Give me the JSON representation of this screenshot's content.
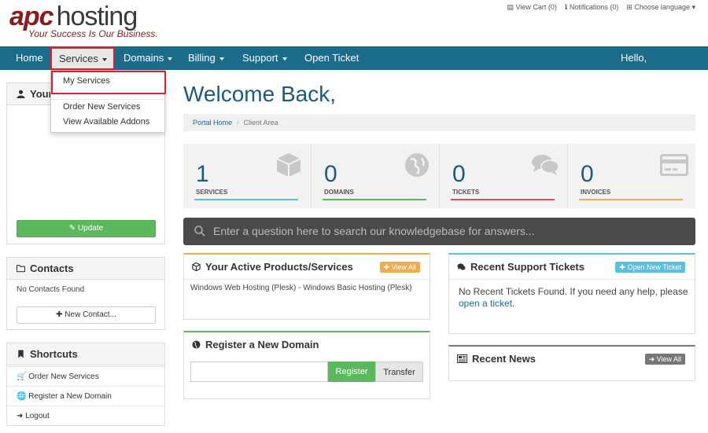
{
  "logo": {
    "brand_a": "apc",
    "brand_b": "hosting",
    "tagline": "Your Success Is Our Business."
  },
  "top_links": {
    "cart": "View Cart (0)",
    "notifications": "Notifications (0)",
    "language": "Choose language"
  },
  "nav": {
    "home": "Home",
    "services": "Services",
    "domains": "Domains",
    "billing": "Billing",
    "support": "Support",
    "open_ticket": "Open Ticket",
    "greeting": "Hello,"
  },
  "services_menu": {
    "my_services": "My Services",
    "order_new": "Order New Services",
    "addons": "View Available Addons"
  },
  "sidebar": {
    "your_info_title": "Your",
    "update_label": "Update",
    "contacts_title": "Contacts",
    "no_contacts": "No Contacts Found",
    "new_contact_label": "New Contact...",
    "shortcuts_title": "Shortcuts",
    "shortcuts": [
      "Order New Services",
      "Register a New Domain",
      "Logout"
    ]
  },
  "main": {
    "welcome": "Welcome Back,",
    "breadcrumb": {
      "home": "Portal Home",
      "current": "Client Area"
    },
    "stats": [
      {
        "value": "1",
        "label": "SERVICES",
        "color": "#5bc0de",
        "icon": "cube-icon"
      },
      {
        "value": "0",
        "label": "DOMAINS",
        "color": "#5cb85c",
        "icon": "globe-icon"
      },
      {
        "value": "0",
        "label": "TICKETS",
        "color": "#d9534f",
        "icon": "comments-icon"
      },
      {
        "value": "0",
        "label": "INVOICES",
        "color": "#f0ad4e",
        "icon": "credit-card-icon"
      }
    ],
    "search_placeholder": "Enter a question here to search our knowledgebase for answers...",
    "products": {
      "title": "Your Active Products/Services",
      "view_all": "View All",
      "item": "Windows Web Hosting (Plesk) - Windows Basic Hosting (Plesk)"
    },
    "tickets": {
      "title": "Recent Support Tickets",
      "open_new": "Open New Ticket",
      "empty_text": "No Recent Tickets Found. If you need any help, please",
      "link": "open a ticket",
      "period": "."
    },
    "domain": {
      "title": "Register a New Domain",
      "register": "Register",
      "transfer": "Transfer"
    },
    "news": {
      "title": "Recent News",
      "view_all": "View All"
    }
  },
  "colors": {
    "nav": "#1c6b8a",
    "brand_red": "#8b1a1a",
    "highlight": "#d9232d",
    "accent_blue": "#1c5b80"
  }
}
